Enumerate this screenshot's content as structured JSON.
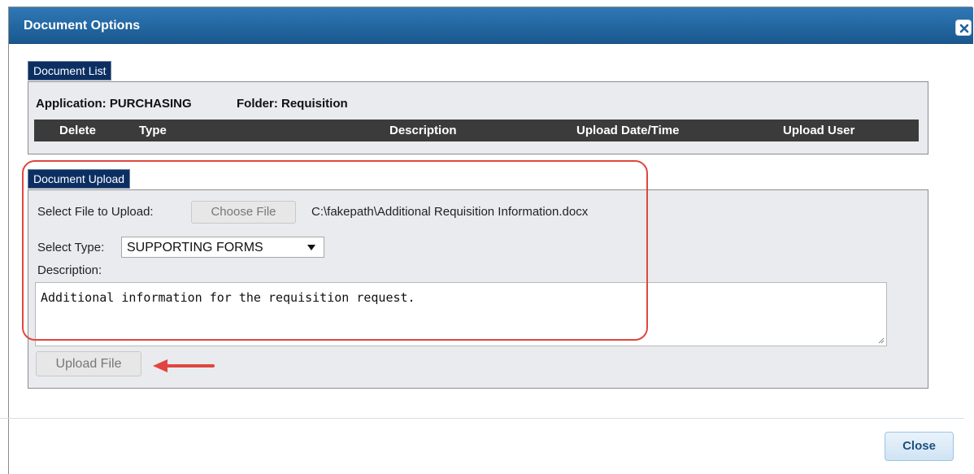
{
  "dialog": {
    "title": "Document Options",
    "close_label": "Close"
  },
  "document_list": {
    "legend": "Document List",
    "application_label": "Application: PURCHASING",
    "folder_label": "Folder: Requisition",
    "columns": [
      "Delete",
      "Type",
      "Description",
      "Upload Date/Time",
      "Upload User"
    ]
  },
  "document_upload": {
    "legend": "Document Upload",
    "select_file_label": "Select File to Upload:",
    "choose_file_label": "Choose File",
    "file_path": "C:\\fakepath\\Additional Requisition Information.docx",
    "select_type_label": "Select Type:",
    "selected_type": "SUPPORTING FORMS",
    "description_label": "Description:",
    "description_value": "Additional information for the requisition request.",
    "upload_button_label": "Upload File"
  },
  "colors": {
    "titlebar": "#1f63a0",
    "legend": "#0c2f63",
    "highlight": "#e0463f"
  },
  "icons": [
    "close-icon",
    "dropdown-caret-icon",
    "resize-grip-icon",
    "arrow-left-icon"
  ]
}
